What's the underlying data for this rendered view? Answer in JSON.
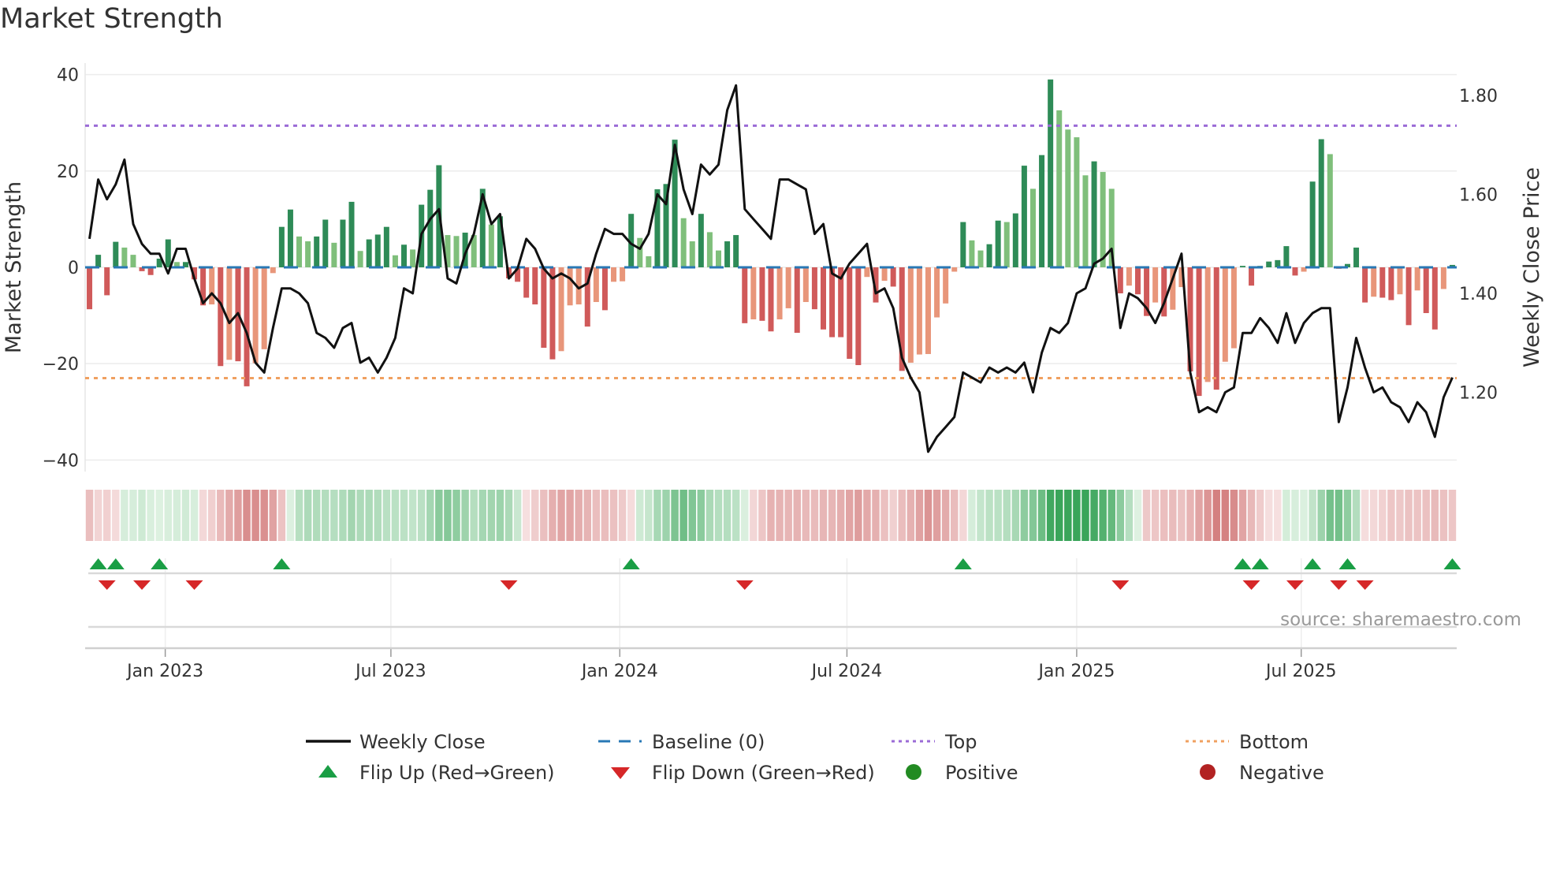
{
  "title": "Market Strength",
  "source": "source: sharemaestro.com",
  "chart_data": {
    "type": "bar",
    "title": "Market Strength",
    "ylabel": "Market Strength",
    "y2label": "Weekly Close Price",
    "ylim": [
      -42.4,
      42.4
    ],
    "y2lim": [
      1.04,
      1.865
    ],
    "yticks": [
      40,
      20,
      0,
      -20,
      -40
    ],
    "ytick_labels": [
      "40",
      "20",
      "0",
      "−20",
      "−40"
    ],
    "y2ticks": [
      1.8,
      1.6,
      1.4,
      1.2
    ],
    "y2tick_labels": [
      "1.80",
      "1.60",
      "1.40",
      "1.20"
    ],
    "xticks": [
      8.67,
      34.5,
      60.7,
      86.7,
      113.0,
      138.7
    ],
    "xtick_labels": [
      "Jan 2023",
      "Jul 2023",
      "Jan 2024",
      "Jul 2024",
      "Jan 2025",
      "Jul 2025"
    ],
    "top_threshold": 29.4,
    "bottom_threshold": -23.0,
    "baseline": 0,
    "strength": [
      -8.7,
      2.6,
      -5.8,
      5.3,
      4.1,
      2.6,
      -0.8,
      -1.6,
      1.8,
      5.8,
      1.1,
      1.1,
      -2.5,
      -7.9,
      -7.7,
      -20.5,
      -19.2,
      -19.5,
      -24.7,
      -19.9,
      -17,
      -1.2,
      8.4,
      12,
      6.4,
      5.4,
      6.4,
      9.9,
      5.1,
      9.9,
      13.6,
      3.4,
      5.8,
      6.8,
      8.4,
      2.5,
      4.7,
      3.7,
      13,
      16.1,
      21.2,
      6.7,
      6.5,
      7.2,
      6.7,
      16.3,
      8.9,
      10.6,
      -2.3,
      -3.0,
      -6.3,
      -7.7,
      -16.7,
      -19.1,
      -17.4,
      -7.9,
      -7.7,
      -12.3,
      -7.2,
      -8.9,
      -3.0,
      -2.9,
      11.1,
      6.1,
      2.3,
      16.2,
      17.3,
      26.5,
      10.2,
      5.4,
      11.1,
      7.3,
      3.5,
      5.4,
      6.7,
      -11.6,
      -10.8,
      -11.1,
      -13.3,
      -10.8,
      -8.5,
      -13.6,
      -7.2,
      -8.7,
      -12.9,
      -14.5,
      -14.5,
      -19,
      -20.3,
      -2.0,
      -7.3,
      -2.8,
      -4.0,
      -21.5,
      -19.8,
      -18.1,
      -18,
      -10.4,
      -7.5,
      -0.9,
      9.4,
      5.6,
      3.5,
      4.8,
      9.7,
      9.4,
      11.2,
      21.1,
      16.3,
      23.3,
      39.0,
      32.6,
      28.6,
      27.0,
      19.1,
      22.0,
      19.8,
      16.3,
      -5.4,
      -3.8,
      -5.6,
      -10.1,
      -7.3,
      -10.2,
      -8.8,
      -4.1,
      -21.6,
      -26.7,
      -23.8,
      -25.4,
      -19.6,
      -16.8,
      0.3,
      -3.8,
      0.3,
      1.2,
      1.5,
      4.4,
      -1.7,
      -0.9,
      17.8,
      26.6,
      23.5,
      -0.3,
      0.7,
      4.1,
      -7.3,
      -6.1,
      -6.3,
      -6.8,
      -5.6,
      -12,
      -4.8,
      -9.5,
      -12.9,
      -4.5,
      0.5
    ],
    "weekly_close": [
      1.51,
      1.63,
      1.59,
      1.62,
      1.67,
      1.54,
      1.5,
      1.48,
      1.48,
      1.44,
      1.49,
      1.49,
      1.43,
      1.38,
      1.4,
      1.38,
      1.34,
      1.36,
      1.32,
      1.26,
      1.24,
      1.33,
      1.41,
      1.41,
      1.4,
      1.38,
      1.32,
      1.31,
      1.29,
      1.33,
      1.34,
      1.26,
      1.27,
      1.24,
      1.27,
      1.31,
      1.41,
      1.4,
      1.52,
      1.55,
      1.57,
      1.43,
      1.42,
      1.48,
      1.52,
      1.6,
      1.54,
      1.56,
      1.43,
      1.45,
      1.51,
      1.49,
      1.45,
      1.43,
      1.44,
      1.43,
      1.41,
      1.42,
      1.48,
      1.53,
      1.52,
      1.52,
      1.5,
      1.49,
      1.52,
      1.6,
      1.58,
      1.7,
      1.61,
      1.56,
      1.66,
      1.64,
      1.66,
      1.77,
      1.82,
      1.57,
      1.55,
      1.53,
      1.51,
      1.63,
      1.63,
      1.62,
      1.61,
      1.52,
      1.54,
      1.44,
      1.43,
      1.46,
      1.48,
      1.5,
      1.4,
      1.41,
      1.37,
      1.27,
      1.23,
      1.2,
      1.08,
      1.11,
      1.13,
      1.15,
      1.24,
      1.23,
      1.22,
      1.25,
      1.24,
      1.25,
      1.24,
      1.26,
      1.2,
      1.28,
      1.33,
      1.32,
      1.34,
      1.4,
      1.41,
      1.46,
      1.47,
      1.49,
      1.33,
      1.4,
      1.39,
      1.37,
      1.34,
      1.38,
      1.43,
      1.48,
      1.24,
      1.16,
      1.17,
      1.16,
      1.2,
      1.21,
      1.32,
      1.32,
      1.35,
      1.33,
      1.3,
      1.36,
      1.3,
      1.34,
      1.36,
      1.37,
      1.37,
      1.14,
      1.21,
      1.31,
      1.25,
      1.2,
      1.21,
      1.18,
      1.17,
      1.14,
      1.18,
      1.16,
      1.11,
      1.19,
      1.23
    ],
    "legend": {
      "placement": "bottom",
      "items": [
        {
          "label": "Weekly Close",
          "symbol": "line"
        },
        {
          "label": "Baseline (0)",
          "symbol": "dash"
        },
        {
          "label": "Top",
          "symbol": "dot-purple"
        },
        {
          "label": "Bottom",
          "symbol": "dot-orange"
        },
        {
          "label": "Flip Up (Red→Green)",
          "symbol": "triangle-up"
        },
        {
          "label": "Flip Down (Green→Red)",
          "symbol": "triangle-down"
        },
        {
          "label": "Positive",
          "symbol": "circle-green"
        },
        {
          "label": "Negative",
          "symbol": "circle-red"
        }
      ]
    },
    "colors": {
      "pos_strong": "#2e8b57",
      "pos_weak": "#7fbf7b",
      "neg_strong": "#d05a5a",
      "neg_weak": "#e8967a",
      "close": "#111111",
      "baseline": "#2878b5",
      "top": "#9b6bd6",
      "bottom": "#f0a060",
      "flip_up": "#1a9e45",
      "flip_down": "#d62728",
      "positive": "#228b22",
      "negative": "#b22222"
    }
  }
}
